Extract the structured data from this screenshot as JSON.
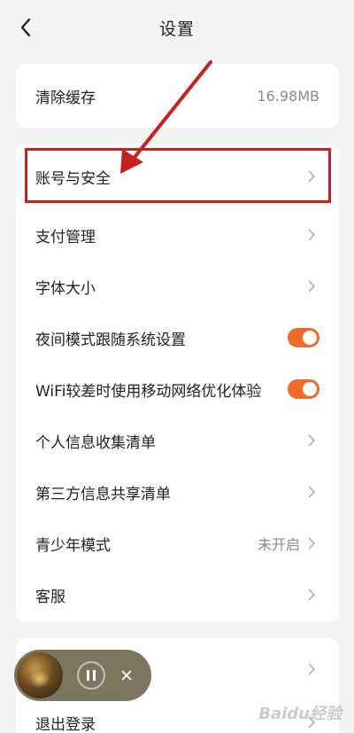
{
  "header": {
    "title": "设置"
  },
  "cache": {
    "label": "清除缓存",
    "value": "16.98MB"
  },
  "settings": {
    "account_security": "账号与安全",
    "payment": "支付管理",
    "font_size": "字体大小",
    "night_mode": "夜间模式跟随系统设置",
    "wifi_optimize": "WiFi较差时使用移动网络优化体验",
    "personal_info": "个人信息收集清单",
    "third_party": "第三方信息共享清单",
    "teen_mode": "青少年模式",
    "teen_mode_value": "未开启",
    "customer_service": "客服"
  },
  "bottom": {
    "logout": "退出登录"
  },
  "toggles": {
    "night_mode_on": true,
    "wifi_optimize_on": true
  },
  "colors": {
    "accent": "#f06a2a",
    "highlight": "#c8201e",
    "background": "#f3f3f3"
  },
  "watermark": "Baidu经验"
}
